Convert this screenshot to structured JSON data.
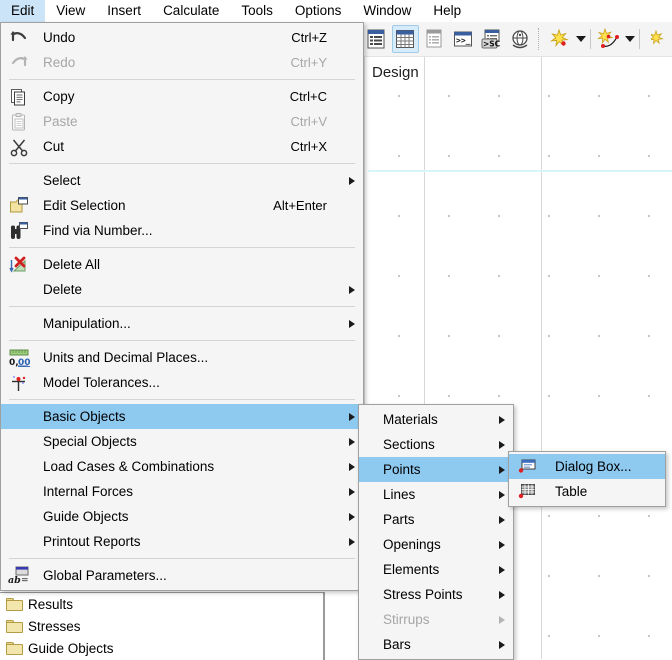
{
  "app": {
    "canvas_label": "Design"
  },
  "menubar": {
    "items": [
      {
        "label": "Edit",
        "active": true
      },
      {
        "label": "View",
        "active": false
      },
      {
        "label": "Insert",
        "active": false
      },
      {
        "label": "Calculate",
        "active": false
      },
      {
        "label": "Tools",
        "active": false
      },
      {
        "label": "Options",
        "active": false
      },
      {
        "label": "Window",
        "active": false
      },
      {
        "label": "Help",
        "active": false
      }
    ]
  },
  "toolbar": {
    "buttons": [
      {
        "name": "list-view-button",
        "checked": false
      },
      {
        "name": "table-view-button",
        "checked": true
      },
      {
        "name": "report-view-button",
        "checked": false
      },
      {
        "name": "command-prompt-button",
        "checked": false
      },
      {
        "name": "script-sc-button",
        "checked": false
      },
      {
        "name": "globe-view-button",
        "checked": false
      },
      {
        "name": "new-point-button",
        "checked": false
      },
      {
        "name": "new-point-dropdown",
        "checked": false
      },
      {
        "name": "new-line-button",
        "checked": false
      },
      {
        "name": "new-line-dropdown",
        "checked": false
      }
    ]
  },
  "edit_menu": {
    "items": [
      {
        "label": "Undo",
        "accel": "Ctrl+Z",
        "icon": "undo-icon",
        "disabled": false,
        "submenu": false
      },
      {
        "label": "Redo",
        "accel": "Ctrl+Y",
        "icon": "redo-icon",
        "disabled": true,
        "submenu": false
      },
      {
        "separator": true
      },
      {
        "label": "Copy",
        "accel": "Ctrl+C",
        "icon": "copy-icon",
        "disabled": false,
        "submenu": false
      },
      {
        "label": "Paste",
        "accel": "Ctrl+V",
        "icon": "paste-icon",
        "disabled": true,
        "submenu": false
      },
      {
        "label": "Cut",
        "accel": "Ctrl+X",
        "icon": "cut-icon",
        "disabled": false,
        "submenu": false
      },
      {
        "separator": true
      },
      {
        "label": "Select",
        "accel": "",
        "icon": "",
        "disabled": false,
        "submenu": true
      },
      {
        "label": "Edit Selection",
        "accel": "Alt+Enter",
        "icon": "edit-selection-icon",
        "disabled": false,
        "submenu": false
      },
      {
        "label": "Find via Number...",
        "accel": "",
        "icon": "binoculars-icon",
        "disabled": false,
        "submenu": false
      },
      {
        "separator": true
      },
      {
        "label": "Delete All",
        "accel": "",
        "icon": "delete-all-icon",
        "disabled": false,
        "submenu": false
      },
      {
        "label": "Delete",
        "accel": "",
        "icon": "",
        "disabled": false,
        "submenu": true
      },
      {
        "separator": true
      },
      {
        "label": "Manipulation...",
        "accel": "",
        "icon": "",
        "disabled": false,
        "submenu": true
      },
      {
        "separator": true
      },
      {
        "label": "Units and Decimal Places...",
        "accel": "",
        "icon": "units-icon",
        "disabled": false,
        "submenu": false
      },
      {
        "label": "Model Tolerances...",
        "accel": "",
        "icon": "tolerances-icon",
        "disabled": false,
        "submenu": false
      },
      {
        "separator": true
      },
      {
        "label": "Basic Objects",
        "accel": "",
        "icon": "",
        "disabled": false,
        "submenu": true,
        "highlight": true
      },
      {
        "label": "Special Objects",
        "accel": "",
        "icon": "",
        "disabled": false,
        "submenu": true
      },
      {
        "label": "Load Cases & Combinations",
        "accel": "",
        "icon": "",
        "disabled": false,
        "submenu": true
      },
      {
        "label": "Internal Forces",
        "accel": "",
        "icon": "",
        "disabled": false,
        "submenu": true
      },
      {
        "label": "Guide Objects",
        "accel": "",
        "icon": "",
        "disabled": false,
        "submenu": true
      },
      {
        "label": "Printout Reports",
        "accel": "",
        "icon": "",
        "disabled": false,
        "submenu": true
      },
      {
        "separator": true
      },
      {
        "label": "Global Parameters...",
        "accel": "",
        "icon": "global-parameters-icon",
        "disabled": false,
        "submenu": false
      }
    ]
  },
  "basic_objects_menu": {
    "items": [
      {
        "label": "Materials",
        "disabled": false,
        "submenu": true
      },
      {
        "label": "Sections",
        "disabled": false,
        "submenu": true
      },
      {
        "label": "Points",
        "disabled": false,
        "submenu": true,
        "highlight": true
      },
      {
        "label": "Lines",
        "disabled": false,
        "submenu": true
      },
      {
        "label": "Parts",
        "disabled": false,
        "submenu": true
      },
      {
        "label": "Openings",
        "disabled": false,
        "submenu": true
      },
      {
        "label": "Elements",
        "disabled": false,
        "submenu": true
      },
      {
        "label": "Stress Points",
        "disabled": false,
        "submenu": true
      },
      {
        "label": "Stirrups",
        "disabled": true,
        "submenu": true
      },
      {
        "label": "Bars",
        "disabled": false,
        "submenu": true
      }
    ]
  },
  "points_menu": {
    "items": [
      {
        "label": "Dialog Box...",
        "icon": "dialog-box-icon",
        "highlight": true
      },
      {
        "label": "Table",
        "icon": "table-icon",
        "highlight": false
      }
    ]
  },
  "tree_panel": {
    "items": [
      {
        "label": "Results",
        "icon": "folder-icon"
      },
      {
        "label": "Stresses",
        "icon": "folder-icon"
      },
      {
        "label": "Guide Objects",
        "icon": "folder-icon"
      }
    ]
  },
  "colors": {
    "menu_highlight": "#8ec9f0",
    "menubar_active": "#cce4f7",
    "menu_bg": "#f5f5f5",
    "guideline_cyan": "#d8f6f8"
  }
}
